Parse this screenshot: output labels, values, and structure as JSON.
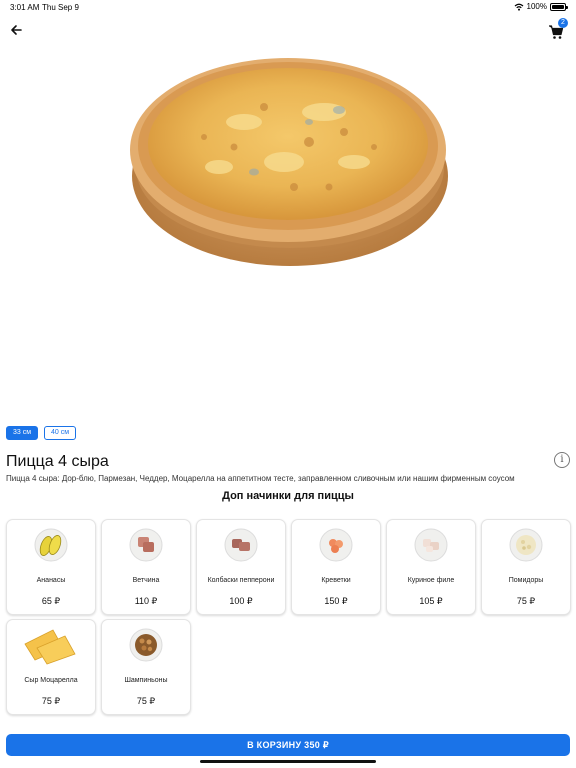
{
  "status_bar": {
    "time": "3:01 AM",
    "date": "Thu Sep 9",
    "battery": "100%",
    "icons": [
      "wifi-icon",
      "battery-icon"
    ]
  },
  "header": {
    "back_icon": "arrow-left-icon",
    "cart_icon": "cart-icon",
    "cart_count": "2"
  },
  "product": {
    "image": "pizza-image",
    "sizes": [
      {
        "label": "33 см",
        "selected": true
      },
      {
        "label": "40 см",
        "selected": false
      }
    ],
    "title": "Пицца 4 сыра",
    "description": "Пицца 4 сыра: Дор-блю, Пармезан, Чеддер, Моцарелла на аппетитном тесте, заправленном сливочным или нашим фирменным соусом",
    "info_icon": "info-icon"
  },
  "toppings": {
    "heading": "Доп начинки для пиццы",
    "items": [
      {
        "name": "Ананасы",
        "price": "65 ₽",
        "icon": "pineapple-icon"
      },
      {
        "name": "Ветчина",
        "price": "110 ₽",
        "icon": "ham-icon"
      },
      {
        "name": "Колбаски пепперони",
        "price": "100 ₽",
        "icon": "pepperoni-icon"
      },
      {
        "name": "Креветки",
        "price": "150 ₽",
        "icon": "shrimp-icon"
      },
      {
        "name": "Куриное филе",
        "price": "105 ₽",
        "icon": "chicken-icon"
      },
      {
        "name": "Помидоры",
        "price": "75 ₽",
        "icon": "tomato-icon"
      },
      {
        "name": "Сыр Моцарелла",
        "price": "75 ₽",
        "icon": "cheese-icon"
      },
      {
        "name": "Шампиньоны",
        "price": "75 ₽",
        "icon": "mushroom-icon"
      }
    ]
  },
  "footer": {
    "add_to_cart_label": "В КОРЗИНУ 350 ₽"
  },
  "colors": {
    "accent": "#1a73e8",
    "background": "#ffffff"
  }
}
